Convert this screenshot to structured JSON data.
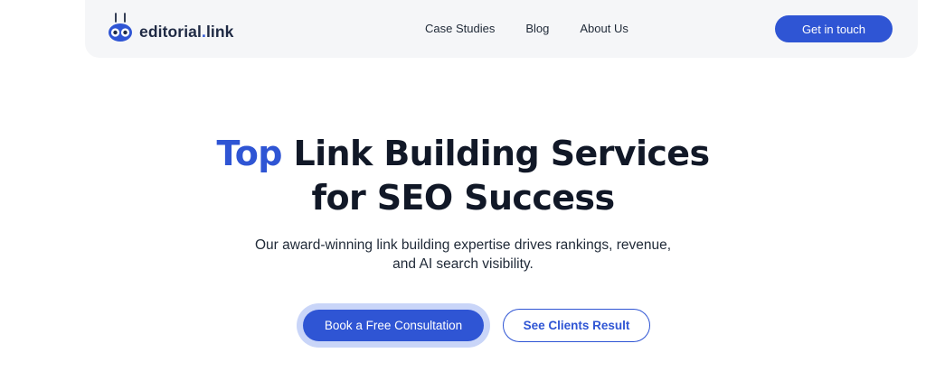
{
  "header": {
    "logo": {
      "name": "editorial",
      "dot": ".",
      "suffix": "link",
      "icon": "robot-face-icon"
    },
    "nav": [
      {
        "label": "Case Studies"
      },
      {
        "label": "Blog"
      },
      {
        "label": "About Us"
      }
    ],
    "cta_label": "Get in touch"
  },
  "hero": {
    "title_accent": "Top",
    "title_rest": " Link Building Services",
    "title_line2": "for SEO Success",
    "subtitle": "Our award-winning link building expertise drives rankings, revenue, and AI search visibility.",
    "primary_button": "Book a Free Consultation",
    "secondary_button": "See Clients Result"
  },
  "colors": {
    "brand": "#2f55d4",
    "header_bg": "#f5f6f8",
    "primary_halo": "#c9d5f8"
  }
}
